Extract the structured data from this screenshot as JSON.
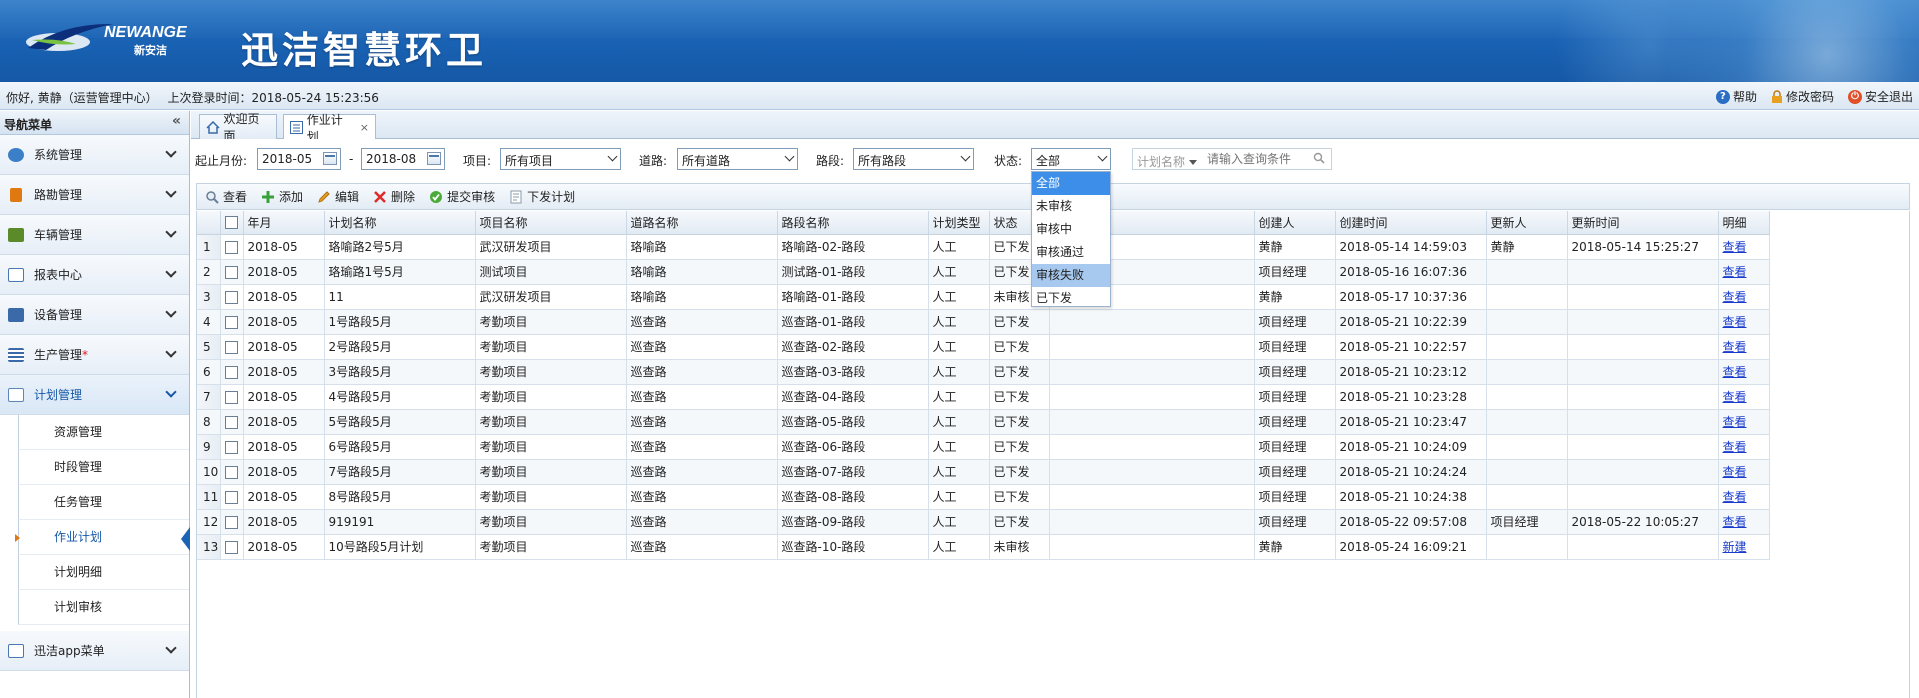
{
  "header": {
    "logo_text": "NEWANGE",
    "logo_sub": "新安洁",
    "app_title": "迅洁智慧环卫"
  },
  "userbar": {
    "greeting": "你好, 黄静（运营管理中心）",
    "last_login": "上次登录时间：2018-05-24 15:23:56",
    "help": "帮助",
    "change_password": "修改密码",
    "logout": "安全退出"
  },
  "sidebar": {
    "title": "导航菜单",
    "items": [
      {
        "label": "系统管理",
        "icon": "gear-icon",
        "color": "#3a7fc8"
      },
      {
        "label": "路勘管理",
        "icon": "person-icon",
        "color": "#e07a10"
      },
      {
        "label": "车辆管理",
        "icon": "truck-icon",
        "color": "#5a8a2a"
      },
      {
        "label": "报表中心",
        "icon": "report-icon",
        "color": "#4a78b0"
      },
      {
        "label": "设备管理",
        "icon": "monitor-icon",
        "color": "#3a6aa8"
      },
      {
        "label": "生产管理",
        "icon": "list-icon",
        "color": "#3a6aa8",
        "star": "*"
      },
      {
        "label": "计划管理",
        "icon": "plan-icon",
        "color": "#5b86b8"
      }
    ],
    "sub_items": [
      "资源管理",
      "时段管理",
      "任务管理",
      "作业计划",
      "计划明细",
      "计划审核"
    ],
    "last_item": {
      "label": "迅洁app菜单",
      "icon": "app-icon",
      "color": "#4a78b0"
    }
  },
  "tabs": [
    {
      "label": "欢迎页面"
    },
    {
      "label": "作业计划",
      "close": "×"
    }
  ],
  "filters": {
    "period_label": "起止月份:",
    "period_start": "2018-05",
    "period_sep": "-",
    "period_end": "2018-08",
    "project_label": "项目:",
    "project_value": "所有项目",
    "road_label": "道路:",
    "road_value": "所有道路",
    "section_label": "路段:",
    "section_value": "所有路段",
    "status_label": "状态:",
    "status_value": "全部",
    "search_type": "计划名称",
    "search_placeholder": "请输入查询条件"
  },
  "status_options": [
    "全部",
    "未审核",
    "审核中",
    "审核通过",
    "审核失败",
    "已下发"
  ],
  "toolbar": {
    "view": "查看",
    "add": "添加",
    "edit": "编辑",
    "delete": "删除",
    "submit": "提交审核",
    "issue": "下发计划"
  },
  "table": {
    "headers": [
      "年月",
      "计划名称",
      "项目名称",
      "道路名称",
      "路段名称",
      "计划类型",
      "状态",
      "",
      "创建人",
      "创建时间",
      "更新人",
      "更新时间",
      "明细"
    ],
    "rows": [
      {
        "n": "1",
        "ym": "2018-05",
        "name": "珞喻路2号5月",
        "proj": "武汉研发项目",
        "road": "珞喻路",
        "sec": "珞喻路-02-路段",
        "type": "人工",
        "status": "已下发",
        "x": "",
        "creator": "黄静",
        "ctime": "2018-05-14 14:59:03",
        "updater": "黄静",
        "utime": "2018-05-14 15:25:27",
        "detail": "查看"
      },
      {
        "n": "2",
        "ym": "2018-05",
        "name": "珞瑜路1号5月",
        "proj": "测试项目",
        "road": "珞喻路",
        "sec": "测试路-01-路段",
        "type": "人工",
        "status": "已下发",
        "x": "",
        "creator": "项目经理",
        "ctime": "2018-05-16 16:07:36",
        "updater": "",
        "utime": "",
        "detail": "查看"
      },
      {
        "n": "3",
        "ym": "2018-05",
        "name": "11",
        "proj": "武汉研发项目",
        "road": "珞喻路",
        "sec": "珞喻路-01-路段",
        "type": "人工",
        "status": "未审核",
        "x": "",
        "creator": "黄静",
        "ctime": "2018-05-17 10:37:36",
        "updater": "",
        "utime": "",
        "detail": "查看"
      },
      {
        "n": "4",
        "ym": "2018-05",
        "name": "1号路段5月",
        "proj": "考勤项目",
        "road": "巡查路",
        "sec": "巡查路-01-路段",
        "type": "人工",
        "status": "已下发",
        "x": "",
        "creator": "项目经理",
        "ctime": "2018-05-21 10:22:39",
        "updater": "",
        "utime": "",
        "detail": "查看"
      },
      {
        "n": "5",
        "ym": "2018-05",
        "name": "2号路段5月",
        "proj": "考勤项目",
        "road": "巡查路",
        "sec": "巡查路-02-路段",
        "type": "人工",
        "status": "已下发",
        "x": "",
        "creator": "项目经理",
        "ctime": "2018-05-21 10:22:57",
        "updater": "",
        "utime": "",
        "detail": "查看"
      },
      {
        "n": "6",
        "ym": "2018-05",
        "name": "3号路段5月",
        "proj": "考勤项目",
        "road": "巡查路",
        "sec": "巡查路-03-路段",
        "type": "人工",
        "status": "已下发",
        "x": "",
        "creator": "项目经理",
        "ctime": "2018-05-21 10:23:12",
        "updater": "",
        "utime": "",
        "detail": "查看"
      },
      {
        "n": "7",
        "ym": "2018-05",
        "name": "4号路段5月",
        "proj": "考勤项目",
        "road": "巡查路",
        "sec": "巡查路-04-路段",
        "type": "人工",
        "status": "已下发",
        "x": "",
        "creator": "项目经理",
        "ctime": "2018-05-21 10:23:28",
        "updater": "",
        "utime": "",
        "detail": "查看"
      },
      {
        "n": "8",
        "ym": "2018-05",
        "name": "5号路段5月",
        "proj": "考勤项目",
        "road": "巡查路",
        "sec": "巡查路-05-路段",
        "type": "人工",
        "status": "已下发",
        "x": "",
        "creator": "项目经理",
        "ctime": "2018-05-21 10:23:47",
        "updater": "",
        "utime": "",
        "detail": "查看"
      },
      {
        "n": "9",
        "ym": "2018-05",
        "name": "6号路段5月",
        "proj": "考勤项目",
        "road": "巡查路",
        "sec": "巡查路-06-路段",
        "type": "人工",
        "status": "已下发",
        "x": "",
        "creator": "项目经理",
        "ctime": "2018-05-21 10:24:09",
        "updater": "",
        "utime": "",
        "detail": "查看"
      },
      {
        "n": "10",
        "ym": "2018-05",
        "name": "7号路段5月",
        "proj": "考勤项目",
        "road": "巡查路",
        "sec": "巡查路-07-路段",
        "type": "人工",
        "status": "已下发",
        "x": "",
        "creator": "项目经理",
        "ctime": "2018-05-21 10:24:24",
        "updater": "",
        "utime": "",
        "detail": "查看"
      },
      {
        "n": "11",
        "ym": "2018-05",
        "name": "8号路段5月",
        "proj": "考勤项目",
        "road": "巡查路",
        "sec": "巡查路-08-路段",
        "type": "人工",
        "status": "已下发",
        "x": "",
        "creator": "项目经理",
        "ctime": "2018-05-21 10:24:38",
        "updater": "",
        "utime": "",
        "detail": "查看"
      },
      {
        "n": "12",
        "ym": "2018-05",
        "name": "919191",
        "proj": "考勤项目",
        "road": "巡查路",
        "sec": "巡查路-09-路段",
        "type": "人工",
        "status": "已下发",
        "x": "",
        "creator": "项目经理",
        "ctime": "2018-05-22 09:57:08",
        "updater": "项目经理",
        "utime": "2018-05-22 10:05:27",
        "detail": "查看"
      },
      {
        "n": "13",
        "ym": "2018-05",
        "name": "10号路段5月计划",
        "proj": "考勤项目",
        "road": "巡查路",
        "sec": "巡查路-10-路段",
        "type": "人工",
        "status": "未审核",
        "x": "",
        "creator": "黄静",
        "ctime": "2018-05-24 16:09:21",
        "updater": "",
        "utime": "",
        "detail": "新建"
      }
    ]
  },
  "colors": {
    "header_blue": "#1a63b5",
    "link_blue": "#1a3ccc",
    "dropdown_selected": "#3d8ee8",
    "dropdown_hover": "#a8c9ef"
  }
}
